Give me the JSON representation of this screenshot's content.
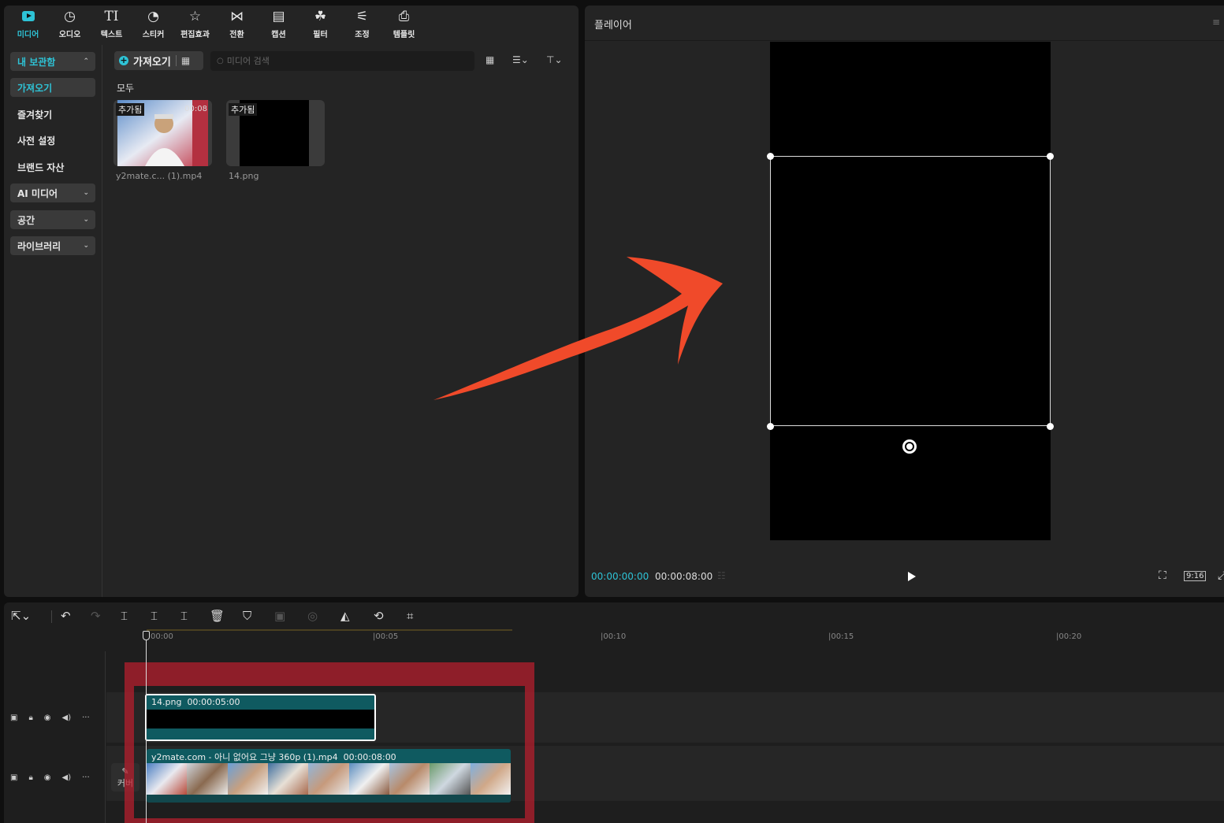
{
  "tabs": [
    {
      "label": "미디어",
      "icon": "media-icon"
    },
    {
      "label": "오디오",
      "icon": "audio-icon"
    },
    {
      "label": "텍스트",
      "icon": "text-icon"
    },
    {
      "label": "스티커",
      "icon": "sticker-icon"
    },
    {
      "label": "편집효과",
      "icon": "effects-icon"
    },
    {
      "label": "전환",
      "icon": "transition-icon"
    },
    {
      "label": "캡션",
      "icon": "caption-icon"
    },
    {
      "label": "필터",
      "icon": "filter-icon"
    },
    {
      "label": "조정",
      "icon": "adjust-icon"
    },
    {
      "label": "템플릿",
      "icon": "template-icon"
    }
  ],
  "sidebar": {
    "my_storage": "내 보관함",
    "import": "가져오기",
    "favorites": "즐겨찾기",
    "presets": "사전 설정",
    "brand_assets": "브랜드 자산",
    "ai_media": "AI 미디어",
    "space": "공간",
    "library": "라이브러리"
  },
  "media": {
    "import_label": "가져오기",
    "search_placeholder": "미디어 검색",
    "section": "모두",
    "items": [
      {
        "name": "y2mate.c... (1).mp4",
        "badge": "추가됨",
        "duration": "00:08"
      },
      {
        "name": "14.png",
        "badge": "추가됨"
      }
    ]
  },
  "player": {
    "title": "플레이어",
    "current_time": "00:00:00:00",
    "total_time": "00:00:08:00",
    "ratio": "9:16"
  },
  "timeline": {
    "ruler": [
      "00:00",
      "|00:05",
      "|00:10",
      "|00:15",
      "|00:20"
    ],
    "overlay_clip": {
      "name": "14.png",
      "duration": "00:00:05:00"
    },
    "main_clip": {
      "name": "y2mate.com - 아니 없어요 그냥 360p (1).mp4",
      "duration": "00:00:08:00"
    },
    "cover_label": "커버"
  },
  "colors": {
    "accent": "#2ec3d6",
    "clip_teal": "#0f5a60",
    "annotation_red": "#be1e2d",
    "arrow": "#f04a2a"
  }
}
